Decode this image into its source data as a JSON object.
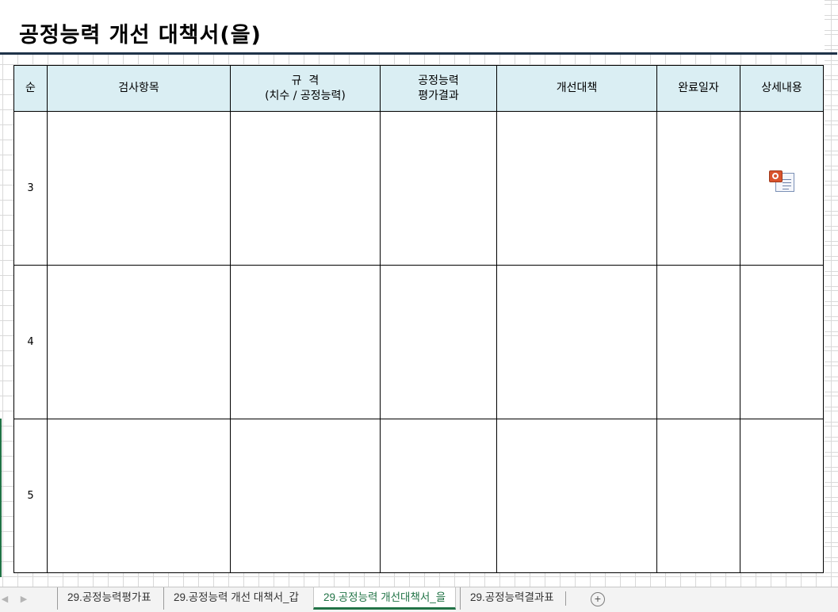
{
  "document": {
    "title": "공정능력 개선 대책서(을)"
  },
  "table": {
    "headers": {
      "no": "순",
      "item": "검사항목",
      "spec_line1": "규  격",
      "spec_line2": "(치수 / 공정능력)",
      "eval_line1": "공정능력",
      "eval_line2": "평가결과",
      "measure": "개선대책",
      "date": "완료일자",
      "detail": "상세내용"
    },
    "rows": [
      {
        "no": "3",
        "attachment_icon": "powerpoint-document-icon"
      },
      {
        "no": "4"
      },
      {
        "no": "5"
      }
    ]
  },
  "sheet_tabs": [
    {
      "label": "29.공정능력평가표",
      "active": false
    },
    {
      "label": "29.공정능력 개선 대책서_갑",
      "active": false
    },
    {
      "label": "29.공정능력 개선대책서_을",
      "active": true
    },
    {
      "label": "29.공정능력결과표",
      "active": false
    }
  ],
  "colors": {
    "header_fill": "#daeef3",
    "title_rule": "#1f3349",
    "active_tab": "#217346"
  }
}
